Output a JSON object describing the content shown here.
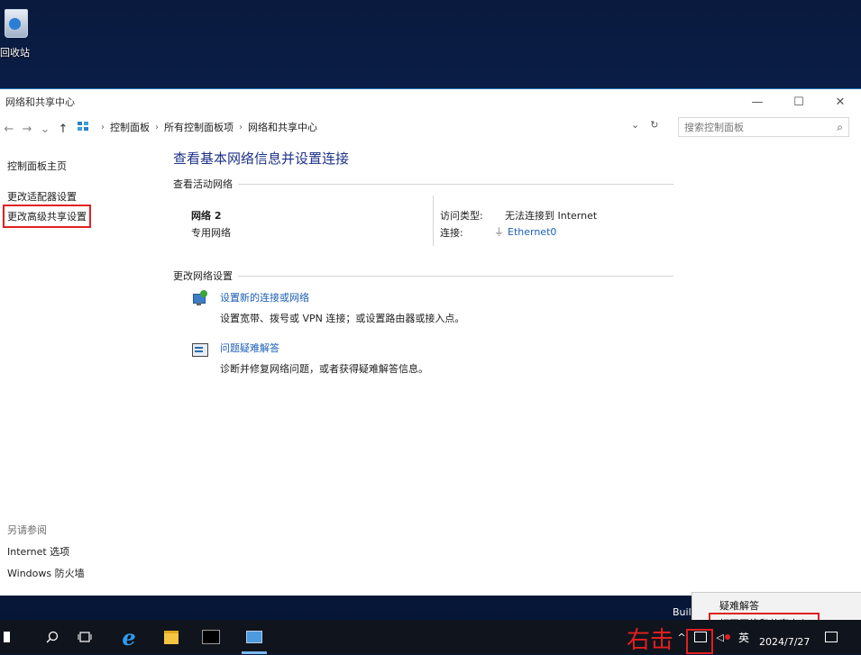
{
  "desktop": {
    "icon_label": "回收站"
  },
  "window": {
    "title": "网络和共享中心",
    "controls": {
      "minimize": "—",
      "maximize": "☐",
      "close": "✕"
    },
    "nav": {
      "back": "←",
      "forward": "→",
      "history": "⌄",
      "up": "↑"
    },
    "breadcrumb": [
      "控制面板",
      "所有控制面板项",
      "网络和共享中心"
    ],
    "address_dropdown": "⌄",
    "refresh": "↻",
    "search_placeholder": "搜索控制面板",
    "search_icon": "⌕"
  },
  "left_pane": {
    "home": "控制面板主页",
    "links": [
      "更改适配器设置",
      "更改高级共享设置"
    ],
    "see_also_title": "另请参阅",
    "see_also": [
      "Internet 选项",
      "Windows 防火墙"
    ]
  },
  "main": {
    "title": "查看基本网络信息并设置连接",
    "active_header": "查看活动网络",
    "network_name": "网络  2",
    "network_type": "专用网络",
    "access_label": "访问类型:",
    "access_value": "无法连接到 Internet",
    "connection_label": "连接:",
    "connection_value": "Ethernet0",
    "change_header": "更改网络设置",
    "tasks": [
      {
        "title": "设置新的连接或网络",
        "desc": "设置宽带、拨号或 VPN 连接；或设置路由器或接入点。"
      },
      {
        "title": "问题疑难解答",
        "desc": "诊断并修复网络问题，或者获得疑难解答信息。"
      }
    ]
  },
  "context_menu": {
    "items": [
      "疑难解答",
      "打开网络和共享中心"
    ]
  },
  "build_text": "Buil",
  "taskbar": {
    "annotation": "右击",
    "ime": "英",
    "date": "2024/7/27"
  },
  "colors": {
    "accent": "#1d5fb5",
    "highlight_red": "#e02020",
    "title_blue": "#1e3287"
  }
}
